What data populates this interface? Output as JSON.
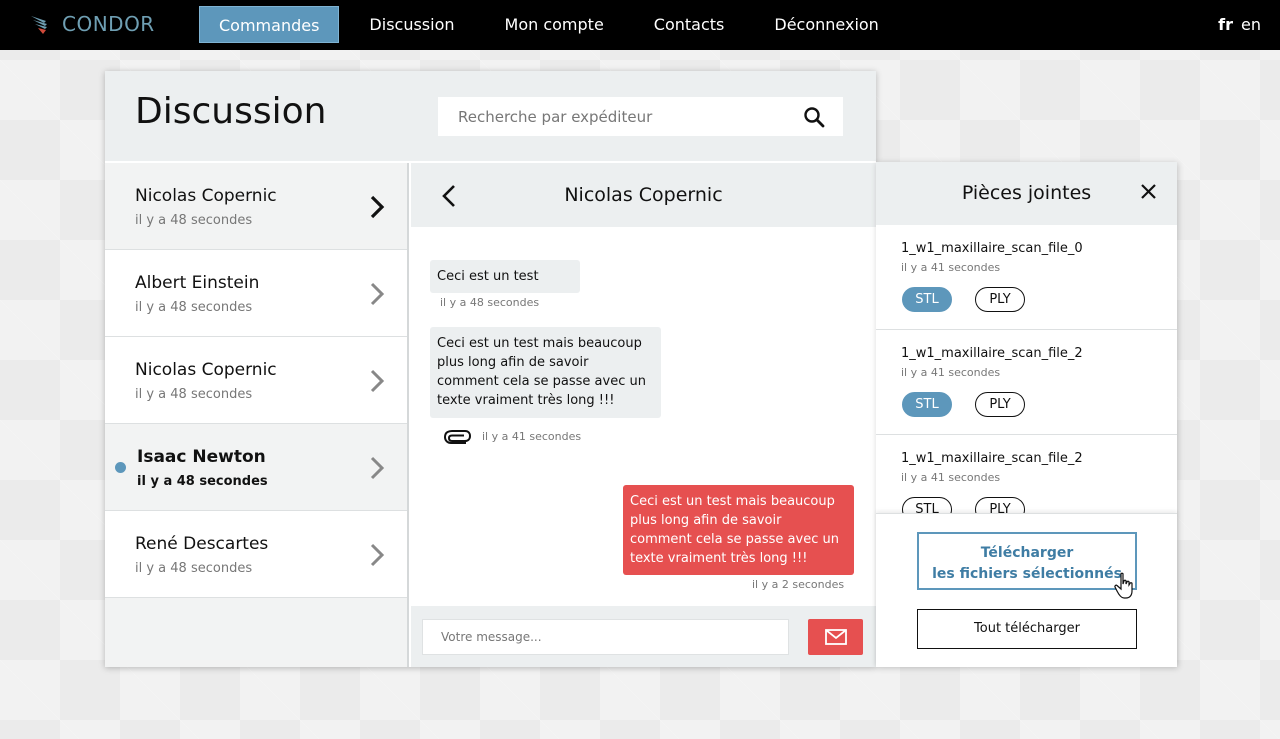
{
  "brand": {
    "name": "CONDOR",
    "logo_icon": "condor-bird-logo"
  },
  "nav": {
    "items": [
      {
        "label": "Commandes",
        "active": true
      },
      {
        "label": "Discussion",
        "active": false
      },
      {
        "label": "Mon compte",
        "active": false
      },
      {
        "label": "Contacts",
        "active": false
      },
      {
        "label": "Déconnexion",
        "active": false
      }
    ],
    "lang": {
      "fr": "fr",
      "en": "en",
      "selected": "fr"
    }
  },
  "discussion": {
    "title": "Discussion",
    "search": {
      "placeholder": "Recherche par expéditeur",
      "value": "",
      "icon": "search-icon"
    }
  },
  "contacts": [
    {
      "name": "Nicolas Copernic",
      "time": "il y a 48 secondes",
      "state": "current"
    },
    {
      "name": "Albert Einstein",
      "time": "il y a 48 secondes",
      "state": "normal"
    },
    {
      "name": "Nicolas Copernic",
      "time": "il y a 48 secondes",
      "state": "normal"
    },
    {
      "name": "Isaac Newton",
      "time": "il y a 48 secondes",
      "state": "unread"
    },
    {
      "name": "René Descartes",
      "time": "il y a 48 secondes",
      "state": "normal"
    }
  ],
  "conversation": {
    "title": "Nicolas Copernic",
    "messages": [
      {
        "text": "Ceci est un test",
        "time": "il y a 48 secondes",
        "from": "them"
      },
      {
        "text": "Ceci est un test mais beaucoup plus long afin de savoir comment cela se passe avec un texte vraiment très long !!!",
        "time": "il y a 41 secondes",
        "from": "them",
        "attachment_icon": "paperclip-icon"
      },
      {
        "text": "Ceci est un test mais beaucoup plus long afin de savoir comment cela se passe avec un texte vraiment très long !!!",
        "time": "il y a 2 secondes",
        "from": "me"
      }
    ],
    "input": {
      "placeholder": "Votre message...",
      "value": ""
    },
    "send_icon": "envelope-icon"
  },
  "attachments": {
    "title": "Pièces jointes",
    "close_icon": "close-icon",
    "files": [
      {
        "name": "1_w1_maxillaire_scan_file_0",
        "time": "il y a 41 secondes",
        "stl": "STL",
        "ply": "PLY",
        "stl_selected": true
      },
      {
        "name": "1_w1_maxillaire_scan_file_2",
        "time": "il y a 41 secondes",
        "stl": "STL",
        "ply": "PLY",
        "stl_selected": true
      },
      {
        "name": "1_w1_maxillaire_scan_file_2",
        "time": "il y a 41 secondes",
        "stl": "STL",
        "ply": "PLY",
        "stl_selected": false
      }
    ],
    "download_selected_line1": "Télécharger",
    "download_selected_line2": "les fichiers sélectionnés",
    "download_all": "Tout télécharger"
  },
  "colors": {
    "accent": "#5d97bb",
    "send": "#e65050",
    "nav_bg": "#000000"
  }
}
